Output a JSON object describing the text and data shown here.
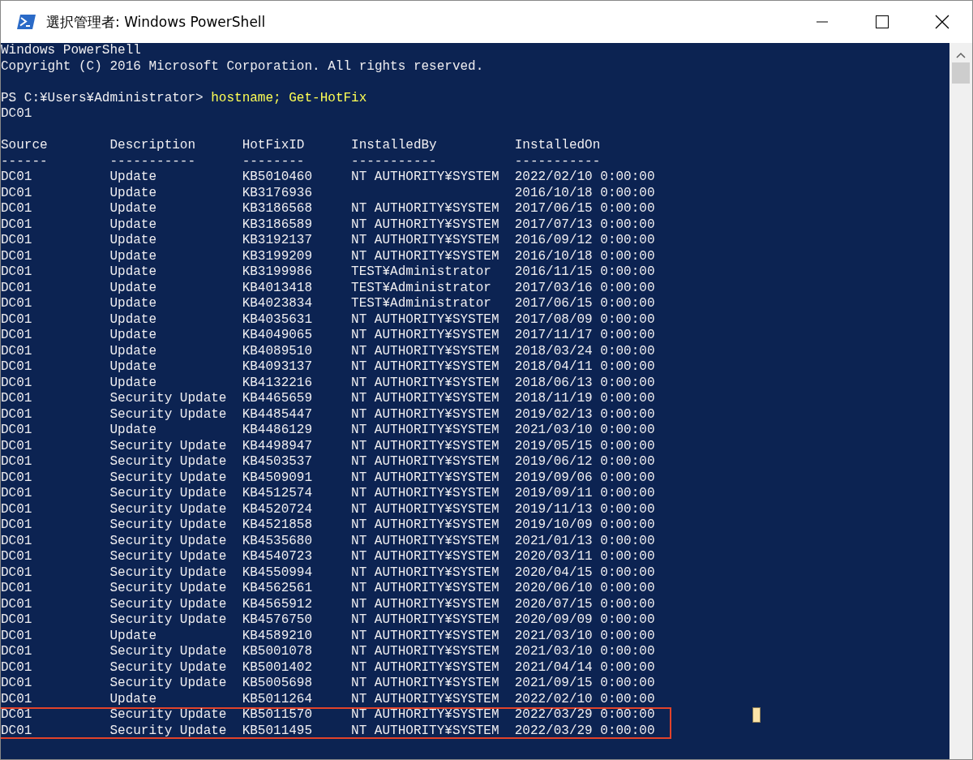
{
  "window": {
    "title": "選択管理者: Windows PowerShell"
  },
  "console": {
    "banner": [
      "Windows PowerShell",
      "Copyright (C) 2016 Microsoft Corporation. All rights reserved."
    ],
    "prompt": "PS C:¥Users¥Administrator>",
    "command": "hostname; Get-HotFix",
    "output": "DC01",
    "columns": [
      {
        "label": "Source",
        "rule": "------"
      },
      {
        "label": "Description",
        "rule": "-----------"
      },
      {
        "label": "HotFixID",
        "rule": "--------"
      },
      {
        "label": "InstalledBy",
        "rule": "-----------"
      },
      {
        "label": "InstalledOn",
        "rule": "-----------"
      }
    ],
    "rows": [
      {
        "source": "DC01",
        "description": "Update",
        "hotfix_id": "KB5010460",
        "installed_by": "NT AUTHORITY¥SYSTEM",
        "installed_on": "2022/02/10 0:00:00",
        "highlighted": false
      },
      {
        "source": "DC01",
        "description": "Update",
        "hotfix_id": "KB3176936",
        "installed_by": "",
        "installed_on": "2016/10/18 0:00:00",
        "highlighted": false
      },
      {
        "source": "DC01",
        "description": "Update",
        "hotfix_id": "KB3186568",
        "installed_by": "NT AUTHORITY¥SYSTEM",
        "installed_on": "2017/06/15 0:00:00",
        "highlighted": false
      },
      {
        "source": "DC01",
        "description": "Update",
        "hotfix_id": "KB3186589",
        "installed_by": "NT AUTHORITY¥SYSTEM",
        "installed_on": "2017/07/13 0:00:00",
        "highlighted": false
      },
      {
        "source": "DC01",
        "description": "Update",
        "hotfix_id": "KB3192137",
        "installed_by": "NT AUTHORITY¥SYSTEM",
        "installed_on": "2016/09/12 0:00:00",
        "highlighted": false
      },
      {
        "source": "DC01",
        "description": "Update",
        "hotfix_id": "KB3199209",
        "installed_by": "NT AUTHORITY¥SYSTEM",
        "installed_on": "2016/10/18 0:00:00",
        "highlighted": false
      },
      {
        "source": "DC01",
        "description": "Update",
        "hotfix_id": "KB3199986",
        "installed_by": "TEST¥Administrator",
        "installed_on": "2016/11/15 0:00:00",
        "highlighted": false
      },
      {
        "source": "DC01",
        "description": "Update",
        "hotfix_id": "KB4013418",
        "installed_by": "TEST¥Administrator",
        "installed_on": "2017/03/16 0:00:00",
        "highlighted": false
      },
      {
        "source": "DC01",
        "description": "Update",
        "hotfix_id": "KB4023834",
        "installed_by": "TEST¥Administrator",
        "installed_on": "2017/06/15 0:00:00",
        "highlighted": false
      },
      {
        "source": "DC01",
        "description": "Update",
        "hotfix_id": "KB4035631",
        "installed_by": "NT AUTHORITY¥SYSTEM",
        "installed_on": "2017/08/09 0:00:00",
        "highlighted": false
      },
      {
        "source": "DC01",
        "description": "Update",
        "hotfix_id": "KB4049065",
        "installed_by": "NT AUTHORITY¥SYSTEM",
        "installed_on": "2017/11/17 0:00:00",
        "highlighted": false
      },
      {
        "source": "DC01",
        "description": "Update",
        "hotfix_id": "KB4089510",
        "installed_by": "NT AUTHORITY¥SYSTEM",
        "installed_on": "2018/03/24 0:00:00",
        "highlighted": false
      },
      {
        "source": "DC01",
        "description": "Update",
        "hotfix_id": "KB4093137",
        "installed_by": "NT AUTHORITY¥SYSTEM",
        "installed_on": "2018/04/11 0:00:00",
        "highlighted": false
      },
      {
        "source": "DC01",
        "description": "Update",
        "hotfix_id": "KB4132216",
        "installed_by": "NT AUTHORITY¥SYSTEM",
        "installed_on": "2018/06/13 0:00:00",
        "highlighted": false
      },
      {
        "source": "DC01",
        "description": "Security Update",
        "hotfix_id": "KB4465659",
        "installed_by": "NT AUTHORITY¥SYSTEM",
        "installed_on": "2018/11/19 0:00:00",
        "highlighted": false
      },
      {
        "source": "DC01",
        "description": "Security Update",
        "hotfix_id": "KB4485447",
        "installed_by": "NT AUTHORITY¥SYSTEM",
        "installed_on": "2019/02/13 0:00:00",
        "highlighted": false
      },
      {
        "source": "DC01",
        "description": "Update",
        "hotfix_id": "KB4486129",
        "installed_by": "NT AUTHORITY¥SYSTEM",
        "installed_on": "2021/03/10 0:00:00",
        "highlighted": false
      },
      {
        "source": "DC01",
        "description": "Security Update",
        "hotfix_id": "KB4498947",
        "installed_by": "NT AUTHORITY¥SYSTEM",
        "installed_on": "2019/05/15 0:00:00",
        "highlighted": false
      },
      {
        "source": "DC01",
        "description": "Security Update",
        "hotfix_id": "KB4503537",
        "installed_by": "NT AUTHORITY¥SYSTEM",
        "installed_on": "2019/06/12 0:00:00",
        "highlighted": false
      },
      {
        "source": "DC01",
        "description": "Security Update",
        "hotfix_id": "KB4509091",
        "installed_by": "NT AUTHORITY¥SYSTEM",
        "installed_on": "2019/09/06 0:00:00",
        "highlighted": false
      },
      {
        "source": "DC01",
        "description": "Security Update",
        "hotfix_id": "KB4512574",
        "installed_by": "NT AUTHORITY¥SYSTEM",
        "installed_on": "2019/09/11 0:00:00",
        "highlighted": false
      },
      {
        "source": "DC01",
        "description": "Security Update",
        "hotfix_id": "KB4520724",
        "installed_by": "NT AUTHORITY¥SYSTEM",
        "installed_on": "2019/11/13 0:00:00",
        "highlighted": false
      },
      {
        "source": "DC01",
        "description": "Security Update",
        "hotfix_id": "KB4521858",
        "installed_by": "NT AUTHORITY¥SYSTEM",
        "installed_on": "2019/10/09 0:00:00",
        "highlighted": false
      },
      {
        "source": "DC01",
        "description": "Security Update",
        "hotfix_id": "KB4535680",
        "installed_by": "NT AUTHORITY¥SYSTEM",
        "installed_on": "2021/01/13 0:00:00",
        "highlighted": false
      },
      {
        "source": "DC01",
        "description": "Security Update",
        "hotfix_id": "KB4540723",
        "installed_by": "NT AUTHORITY¥SYSTEM",
        "installed_on": "2020/03/11 0:00:00",
        "highlighted": false
      },
      {
        "source": "DC01",
        "description": "Security Update",
        "hotfix_id": "KB4550994",
        "installed_by": "NT AUTHORITY¥SYSTEM",
        "installed_on": "2020/04/15 0:00:00",
        "highlighted": false
      },
      {
        "source": "DC01",
        "description": "Security Update",
        "hotfix_id": "KB4562561",
        "installed_by": "NT AUTHORITY¥SYSTEM",
        "installed_on": "2020/06/10 0:00:00",
        "highlighted": false
      },
      {
        "source": "DC01",
        "description": "Security Update",
        "hotfix_id": "KB4565912",
        "installed_by": "NT AUTHORITY¥SYSTEM",
        "installed_on": "2020/07/15 0:00:00",
        "highlighted": false
      },
      {
        "source": "DC01",
        "description": "Security Update",
        "hotfix_id": "KB4576750",
        "installed_by": "NT AUTHORITY¥SYSTEM",
        "installed_on": "2020/09/09 0:00:00",
        "highlighted": false
      },
      {
        "source": "DC01",
        "description": "Update",
        "hotfix_id": "KB4589210",
        "installed_by": "NT AUTHORITY¥SYSTEM",
        "installed_on": "2021/03/10 0:00:00",
        "highlighted": false
      },
      {
        "source": "DC01",
        "description": "Security Update",
        "hotfix_id": "KB5001078",
        "installed_by": "NT AUTHORITY¥SYSTEM",
        "installed_on": "2021/03/10 0:00:00",
        "highlighted": false
      },
      {
        "source": "DC01",
        "description": "Security Update",
        "hotfix_id": "KB5001402",
        "installed_by": "NT AUTHORITY¥SYSTEM",
        "installed_on": "2021/04/14 0:00:00",
        "highlighted": false
      },
      {
        "source": "DC01",
        "description": "Security Update",
        "hotfix_id": "KB5005698",
        "installed_by": "NT AUTHORITY¥SYSTEM",
        "installed_on": "2021/09/15 0:00:00",
        "highlighted": false
      },
      {
        "source": "DC01",
        "description": "Update",
        "hotfix_id": "KB5011264",
        "installed_by": "NT AUTHORITY¥SYSTEM",
        "installed_on": "2022/02/10 0:00:00",
        "highlighted": false
      },
      {
        "source": "DC01",
        "description": "Security Update",
        "hotfix_id": "KB5011570",
        "installed_by": "NT AUTHORITY¥SYSTEM",
        "installed_on": "2022/03/29 0:00:00",
        "highlighted": true
      },
      {
        "source": "DC01",
        "description": "Security Update",
        "hotfix_id": "KB5011495",
        "installed_by": "NT AUTHORITY¥SYSTEM",
        "installed_on": "2022/03/29 0:00:00",
        "highlighted": true
      }
    ]
  }
}
